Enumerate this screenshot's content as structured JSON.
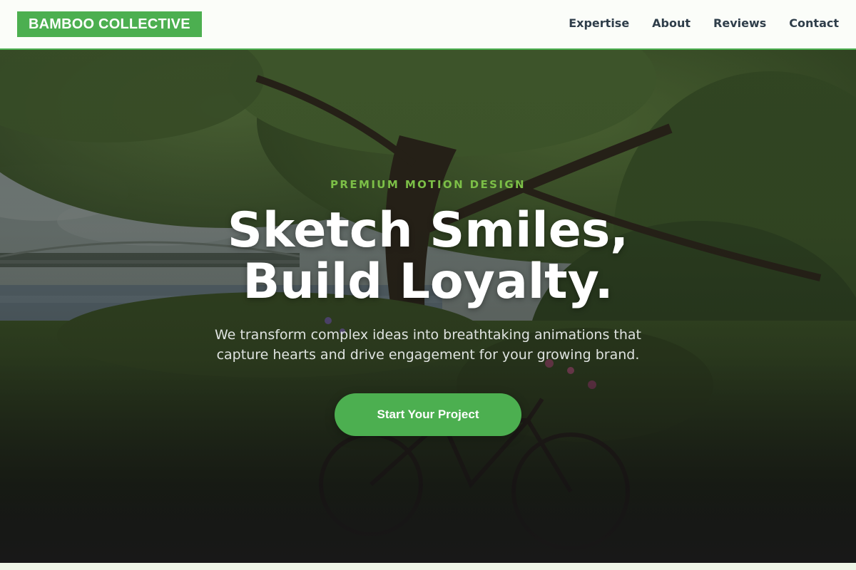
{
  "header": {
    "logo": "BAMBOO COLLECTIVE",
    "nav": [
      "Expertise",
      "About",
      "Reviews",
      "Contact"
    ]
  },
  "hero": {
    "eyebrow": "PREMIUM MOTION DESIGN",
    "headline_line1": "Sketch Smiles,",
    "headline_line2": "Build Loyalty.",
    "subtitle": "We transform complex ideas into breathtaking animations that capture hearts and drive engagement for your growing brand.",
    "cta_label": "Start Your Project"
  },
  "colors": {
    "accent": "#4caf50",
    "eyebrow": "#7cbf47",
    "nav_text": "#2f3e4a",
    "header_bg": "#fbfdf9"
  }
}
